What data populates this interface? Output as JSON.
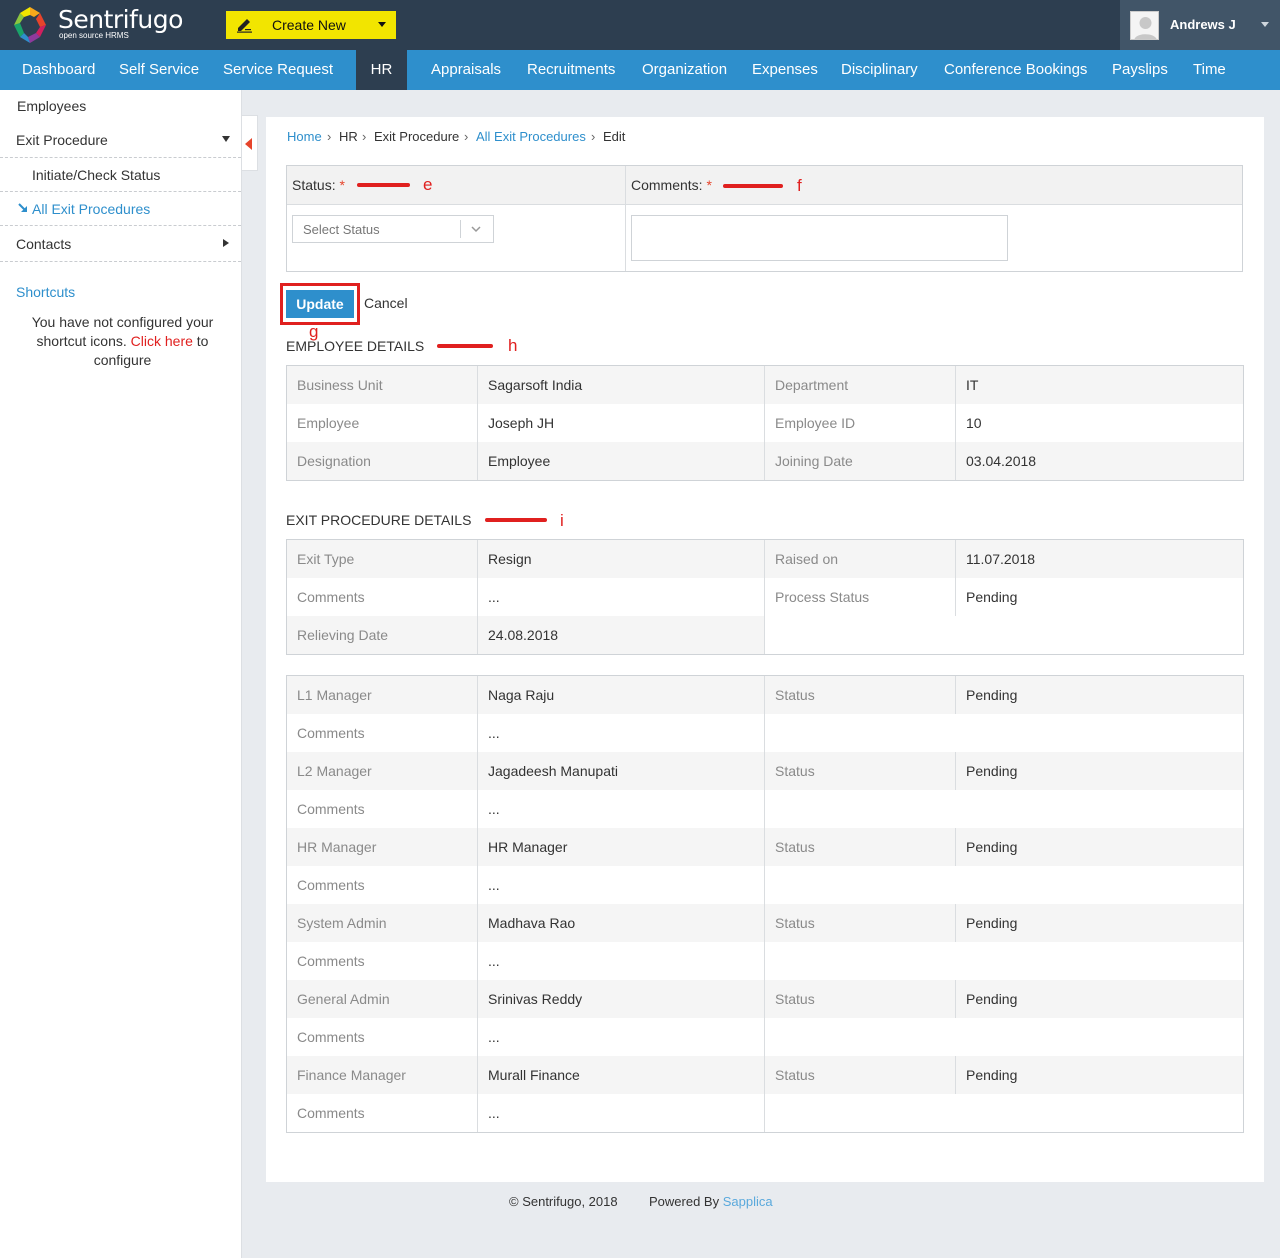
{
  "app": {
    "logo_text": "Sentrifugo",
    "logo_sub": "open source HRMS",
    "create_new_label": "Create New",
    "user_name": "Andrews J"
  },
  "colors": {
    "topbar": "#2d3e50",
    "nav": "#2e8fcc",
    "create_new": "#f2e500",
    "annotation_red": "#e0201f",
    "required": "#e6442b"
  },
  "nav": {
    "items": [
      "Dashboard",
      "Self Service",
      "Service Request",
      "HR",
      "Appraisals",
      "Recruitments",
      "Organization",
      "Expenses",
      "Disciplinary",
      "Conference Bookings",
      "Payslips",
      "Time"
    ],
    "active": "HR"
  },
  "sidebar": {
    "employees": "Employees",
    "exit_procedure": "Exit Procedure",
    "initiate": "Initiate/Check Status",
    "all_exit": "All Exit Procedures",
    "contacts": "Contacts",
    "shortcuts_title": "Shortcuts",
    "shortcuts_msg_1": "You have not configured your",
    "shortcuts_msg_2": "shortcut icons.",
    "shortcuts_link": "Click here",
    "shortcuts_msg_3": "to",
    "shortcuts_msg_4": "configure"
  },
  "breadcrumb": {
    "home": "Home",
    "hr": "HR",
    "exit": "Exit Procedure",
    "all": "All Exit Procedures",
    "edit": "Edit",
    "sep": "›"
  },
  "form": {
    "status_label": "Status:",
    "comments_label": "Comments:",
    "required_mark": "*",
    "status_placeholder": "Select Status",
    "comments_value": "",
    "update_label": "Update",
    "cancel_label": "Cancel"
  },
  "annotations": {
    "e": "e",
    "f": "f",
    "g": "g",
    "h": "h",
    "i": "i"
  },
  "employee_details": {
    "title": "EMPLOYEE DETAILS",
    "rows": [
      {
        "l1": "Business Unit",
        "v1": "Sagarsoft India",
        "l2": "Department",
        "v2": "IT"
      },
      {
        "l1": "Employee",
        "v1": "Joseph JH",
        "l2": "Employee ID",
        "v2": "10"
      },
      {
        "l1": "Designation",
        "v1": "Employee",
        "l2": "Joining Date",
        "v2": "03.04.2018"
      }
    ]
  },
  "exit_details": {
    "title": "EXIT PROCEDURE DETAILS",
    "rows": [
      {
        "l1": "Exit Type",
        "v1": "Resign",
        "l2": "Raised on",
        "v2": "11.07.2018"
      },
      {
        "l1": "Comments",
        "v1": "...",
        "l2": "Process Status",
        "v2": "Pending"
      },
      {
        "l1": "Relieving Date",
        "v1": "24.08.2018",
        "l2": "",
        "v2": ""
      }
    ]
  },
  "approvals": {
    "rows": [
      {
        "l1": "L1 Manager",
        "v1": "Naga Raju",
        "l2": "Status",
        "v2": "Pending"
      },
      {
        "l1": "Comments",
        "v1": "...",
        "l2": "",
        "v2": ""
      },
      {
        "l1": "L2 Manager",
        "v1": "Jagadeesh Manupati",
        "l2": "Status",
        "v2": "Pending"
      },
      {
        "l1": "Comments",
        "v1": "...",
        "l2": "",
        "v2": ""
      },
      {
        "l1": "HR Manager",
        "v1": "HR Manager",
        "l2": "Status",
        "v2": "Pending"
      },
      {
        "l1": "Comments",
        "v1": "...",
        "l2": "",
        "v2": ""
      },
      {
        "l1": "System Admin",
        "v1": "Madhava Rao",
        "l2": "Status",
        "v2": "Pending"
      },
      {
        "l1": "Comments",
        "v1": "...",
        "l2": "",
        "v2": ""
      },
      {
        "l1": "General Admin",
        "v1": "Srinivas Reddy",
        "l2": "Status",
        "v2": "Pending"
      },
      {
        "l1": "Comments",
        "v1": "...",
        "l2": "",
        "v2": ""
      },
      {
        "l1": "Finance Manager",
        "v1": "Murall Finance",
        "l2": "Status",
        "v2": "Pending"
      },
      {
        "l1": "Comments",
        "v1": "...",
        "l2": "",
        "v2": ""
      }
    ]
  },
  "footer": {
    "copyright": "© Sentrifugo, 2018",
    "powered": "Powered By",
    "powered_link": "Sapplica"
  }
}
